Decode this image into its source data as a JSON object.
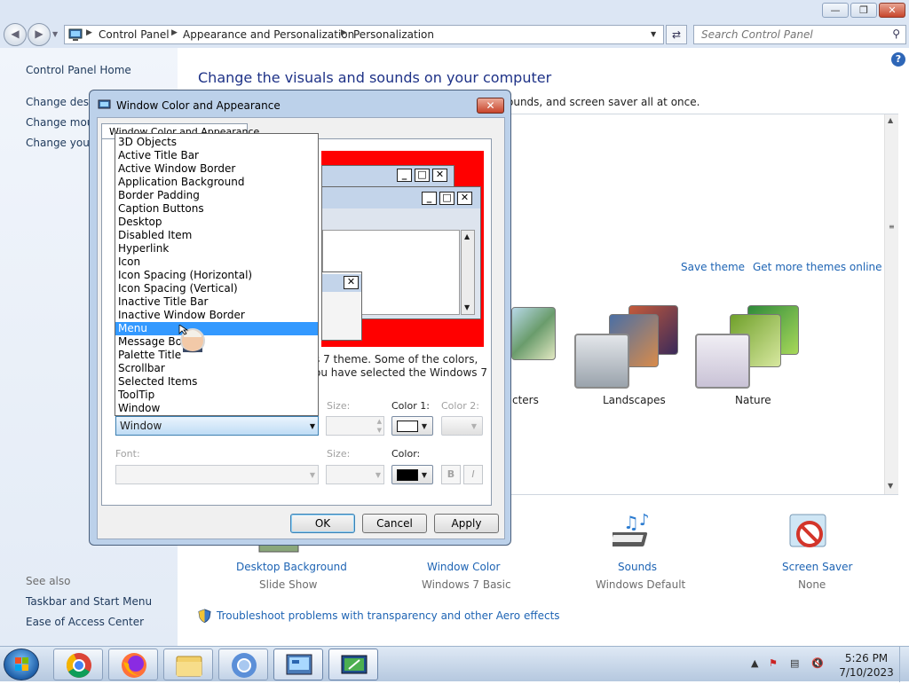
{
  "breadcrumbs": [
    "Control Panel",
    "Appearance and Personalization",
    "Personalization"
  ],
  "search": {
    "placeholder": "Search Control Panel"
  },
  "left_nav": {
    "home": "Control Panel Home",
    "links": [
      "Change deskt",
      "Change mous",
      "Change your"
    ],
    "see_also_label": "See also",
    "see_also": [
      "Taskbar and Start Menu",
      "Ease of Access Center"
    ]
  },
  "main": {
    "headline": "Change the visuals and sounds on your computer",
    "subline": "ounds, and screen saver all at once.",
    "save_theme": "Save theme",
    "more_themes": "Get more themes online",
    "themes": [
      {
        "label": "cters"
      },
      {
        "label": "Landscapes"
      },
      {
        "label": "Nature"
      }
    ],
    "bottom_items": [
      {
        "label": "Desktop Background",
        "value": "Slide Show"
      },
      {
        "label": "Window Color",
        "value": "Windows 7 Basic"
      },
      {
        "label": "Sounds",
        "value": "Windows Default"
      },
      {
        "label": "Screen Saver",
        "value": "None"
      }
    ],
    "troubleshoot": "Troubleshoot problems with transparency and other Aero effects"
  },
  "dialog": {
    "title": "Window Color and Appearance",
    "tab": "Window Color and Appearance",
    "desc_line1": "s 7 theme.  Some of the colors,",
    "desc_line2": "ou have selected the Windows 7",
    "item_value": "Window",
    "size_label": "Size:",
    "color1_label": "Color 1:",
    "color2_label": "Color 2:",
    "font_label": "Font:",
    "font_size_label": "Size:",
    "font_color_label": "Color:",
    "bold": "B",
    "italic": "I",
    "ok": "OK",
    "cancel": "Cancel",
    "apply": "Apply",
    "color1": "#ffffff",
    "font_color": "#000000",
    "dropdown_items": [
      "3D Objects",
      "Active Title Bar",
      "Active Window Border",
      "Application Background",
      "Border Padding",
      "Caption Buttons",
      "Desktop",
      "Disabled Item",
      "Hyperlink",
      "Icon",
      "Icon Spacing (Horizontal)",
      "Icon Spacing (Vertical)",
      "Inactive Title Bar",
      "Inactive Window Border",
      "Menu",
      "Message Box",
      "Palette Title",
      "Scrollbar",
      "Selected Items",
      "ToolTip",
      "Window"
    ],
    "selected_item": "Menu"
  },
  "taskbar": {
    "time": "5:26 PM",
    "date": "7/10/2023",
    "apps": [
      "chrome-icon",
      "firefox-icon",
      "file-explorer-icon",
      "chromium-icon",
      "control-panel-icon",
      "personalization-icon"
    ]
  },
  "colors": {
    "link": "#1e64b4",
    "headline": "#1e3287",
    "preview_bg": "#ff0000",
    "selection": "#3399ff"
  }
}
